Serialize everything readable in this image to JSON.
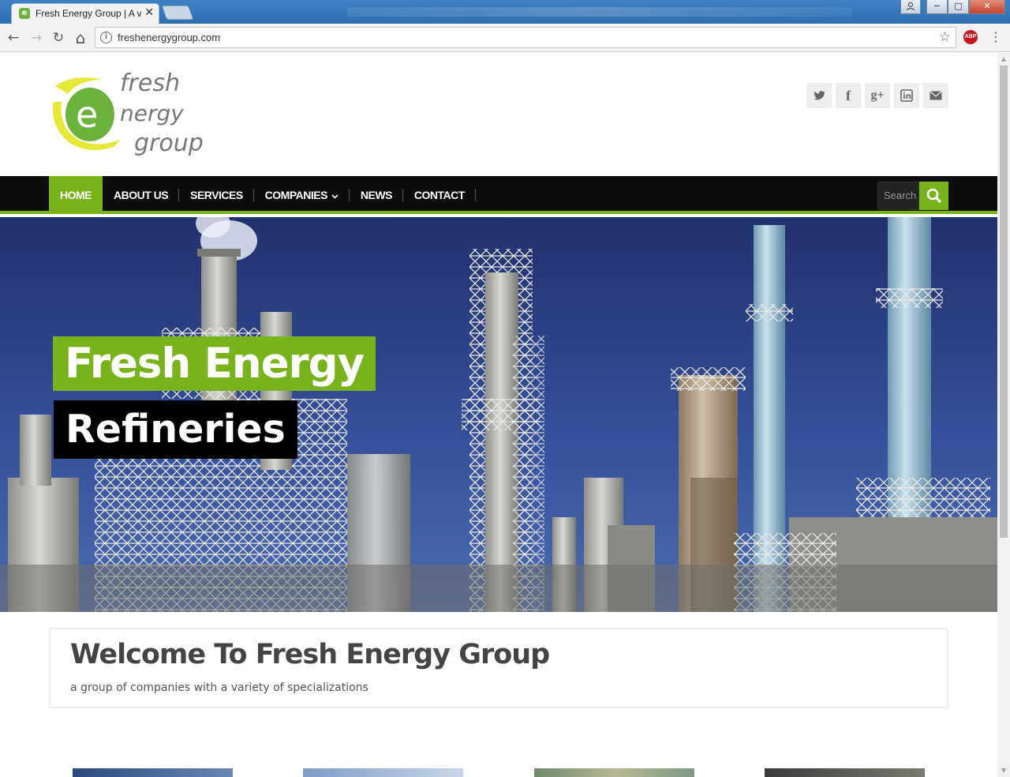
{
  "browser": {
    "tab_title": "Fresh Energy Group | A v",
    "tab_close": "✕",
    "url": "freshenergygroup.com",
    "window_buttons": [
      "−",
      "□",
      "✕"
    ],
    "back_icon": "←",
    "forward_icon": "→",
    "reload_icon": "↻",
    "home_icon": "⌂",
    "info_icon": "i",
    "star_icon": "☆",
    "adblock": "ABP",
    "menu_icon": "⋮"
  },
  "header": {
    "logo_text": [
      "fresh",
      "nergy",
      "group"
    ],
    "logo_letter": "e",
    "social": [
      {
        "name": "twitter-icon",
        "glyph": "t"
      },
      {
        "name": "facebook-icon",
        "glyph": "f"
      },
      {
        "name": "google-plus-icon",
        "glyph": "g+"
      },
      {
        "name": "linkedin-icon",
        "glyph": "in"
      },
      {
        "name": "email-icon",
        "glyph": "✉"
      }
    ]
  },
  "nav": {
    "items": [
      {
        "label": "HOME",
        "active": true
      },
      {
        "label": "ABOUT US"
      },
      {
        "label": "SERVICES"
      },
      {
        "label": "COMPANIES",
        "caret": "⌄"
      },
      {
        "label": "NEWS"
      },
      {
        "label": "CONTACT"
      }
    ],
    "search_placeholder": "Search"
  },
  "hero": {
    "title": "Fresh Energy",
    "subtitle": "Refineries"
  },
  "welcome": {
    "title": "Welcome To Fresh Energy Group",
    "subtitle": "a group of companies with a variety of specializations"
  },
  "colors": {
    "accent": "#79b31c",
    "nav_bg": "#0d0d0d"
  }
}
